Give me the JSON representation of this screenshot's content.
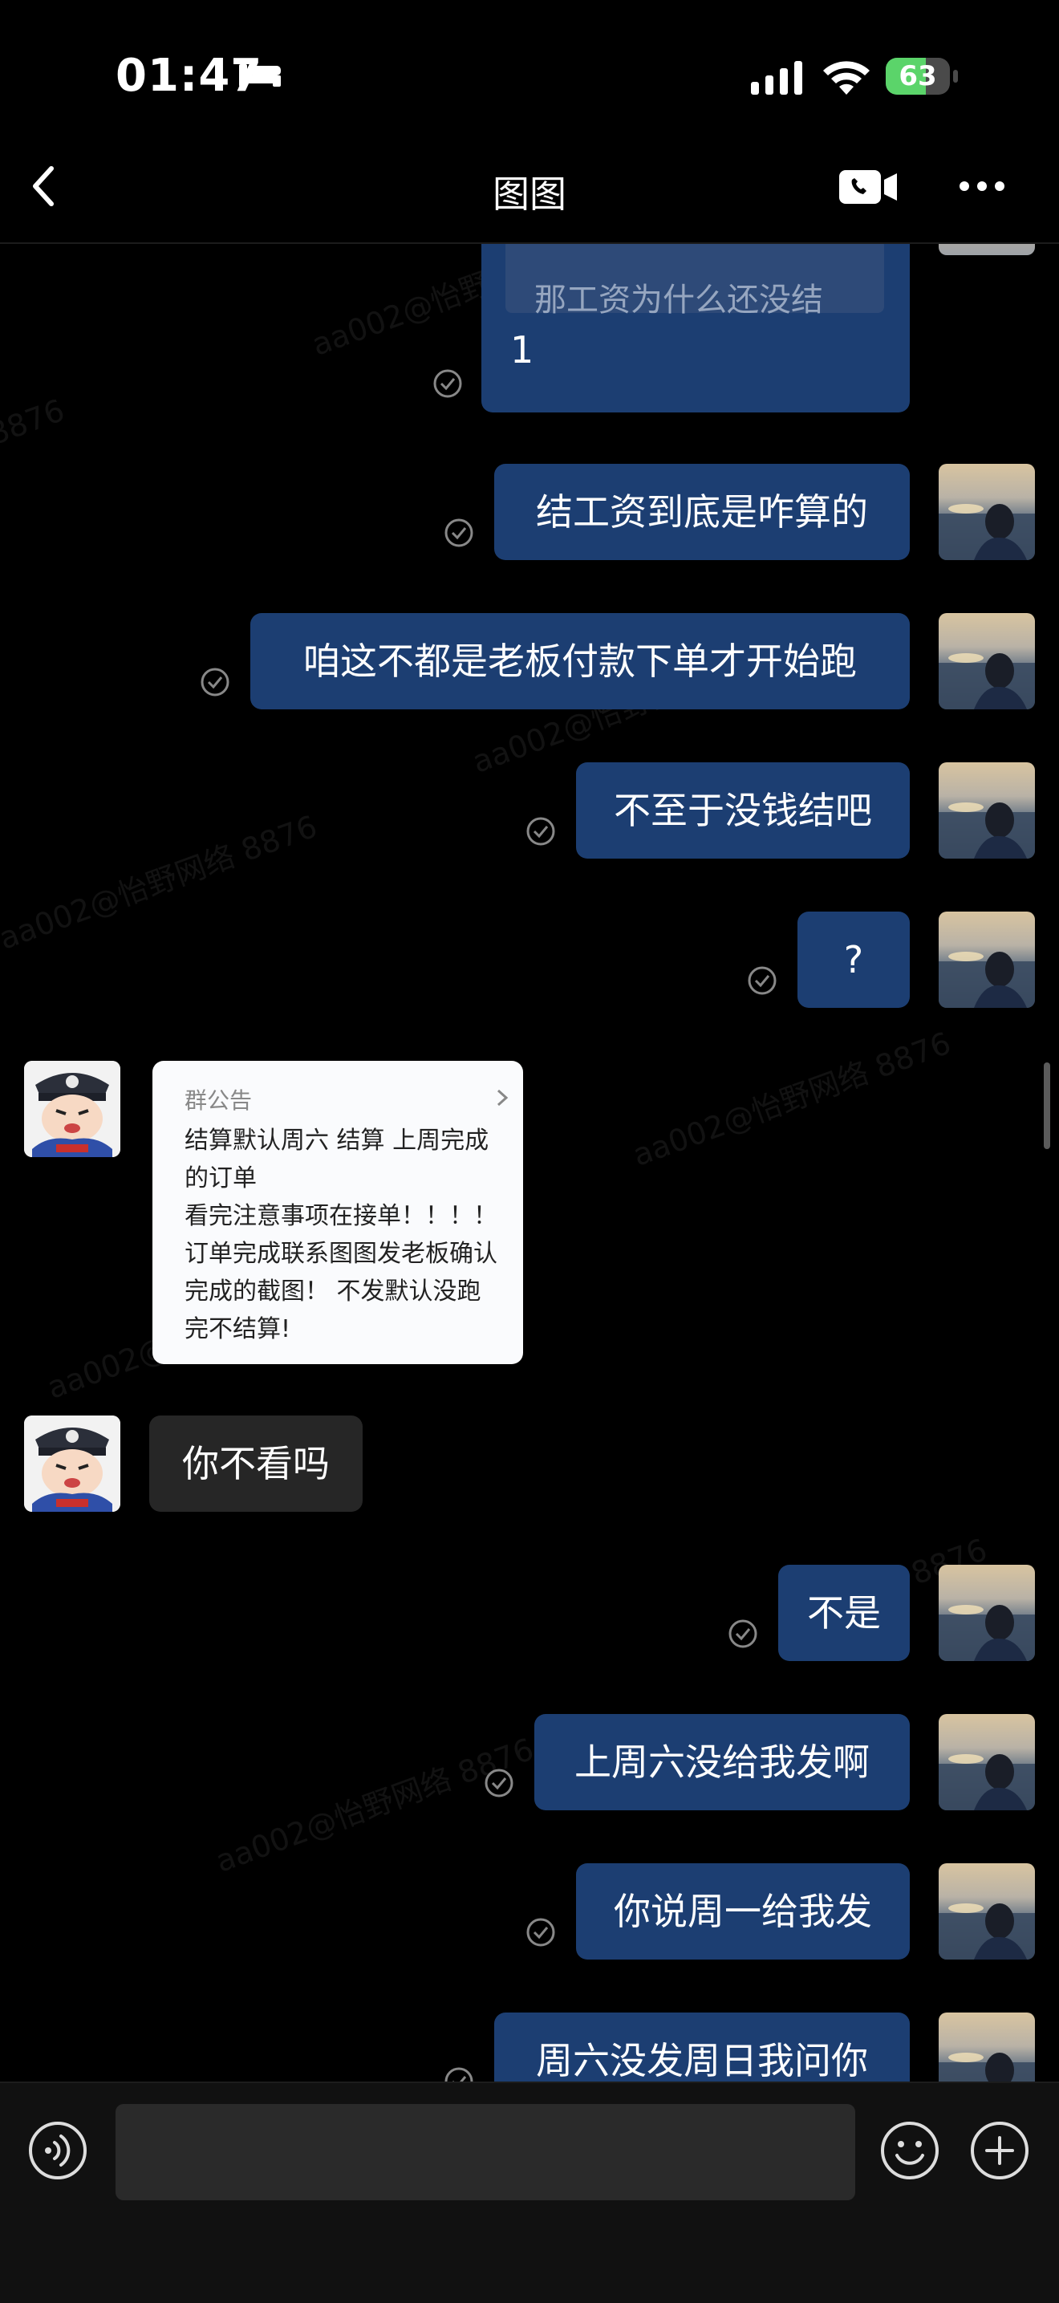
{
  "status_bar": {
    "time": "01:47",
    "battery": "63",
    "battery_level": 0.63
  },
  "nav": {
    "title": "图图"
  },
  "messages": {
    "quoted": "那工资为什么还没结",
    "m1": "1",
    "m2": "结工资到底是咋算的",
    "m3": "咱这不都是老板付款下单才开始跑",
    "m4": "不至于没钱结吧",
    "m5": "?",
    "notice_header": "群公告",
    "notice_body": "结算默认周六 结算 上周完成\n的订单\n看完注意事项在接单！！！！\n订单完成联系图图发老板确认\n完成的截图！ 不发默认没跑\n完不结算!",
    "m6": "你不看吗",
    "m7": "不是",
    "m8": "上周六没给我发啊",
    "m9": "你说周一给我发",
    "m10": "周六没发周日我问你"
  },
  "watermark_text": "aa002@怡野网络 8876",
  "watermark_fragment": "8876",
  "colors": {
    "outgoing_bubble": "#1c3e72",
    "incoming_bubble": "#262626",
    "battery_green": "#5bd46a"
  },
  "icons": [
    "back-icon",
    "video-call-icon",
    "more-icon",
    "voice-icon",
    "emoji-icon",
    "plus-icon",
    "read-check-icon"
  ]
}
